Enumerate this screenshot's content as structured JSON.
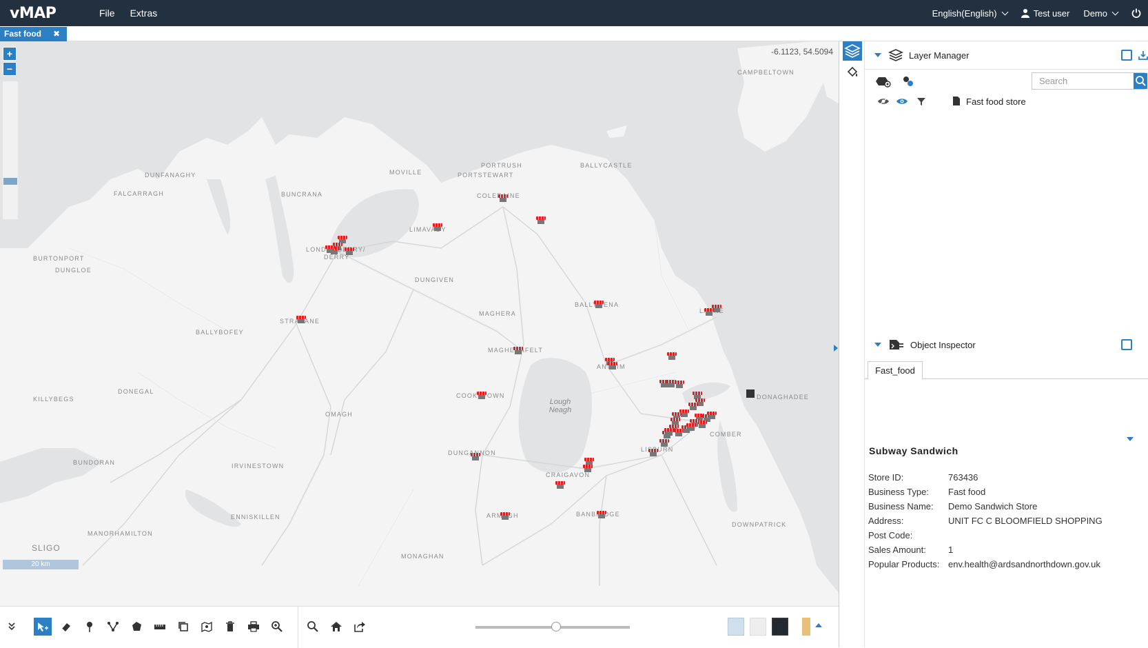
{
  "app": {
    "logo": "vMAP",
    "menu": [
      "File",
      "Extras"
    ],
    "language": "English(English)",
    "user": "Test user",
    "workspace": "Demo"
  },
  "tabs": [
    {
      "label": "Fast food",
      "close": "✖"
    }
  ],
  "map": {
    "coordinate": "-6.1123, 54.5094",
    "scale": "20 km",
    "zoom_in": "+",
    "zoom_out": "−",
    "places": [
      {
        "label": "CAMPBELTOWN"
      },
      {
        "label": "PORTRUSH"
      },
      {
        "label": "PORTSTEWART"
      },
      {
        "label": "BALLYCASTLE"
      },
      {
        "label": "MOVILLE"
      },
      {
        "label": "DUNFANAGHY"
      },
      {
        "label": "FALCARRAGH"
      },
      {
        "label": "BUNCRANA"
      },
      {
        "label": "COLERAINE"
      },
      {
        "label": "LIMAVADY"
      },
      {
        "label": "LONDONDERRY/"
      },
      {
        "label": "DERRY"
      },
      {
        "label": "BURTONPORT"
      },
      {
        "label": "DUNGLOE"
      },
      {
        "label": "DUNGIVEN"
      },
      {
        "label": "BALLYMENA"
      },
      {
        "label": "LARNE"
      },
      {
        "label": "STRABANE"
      },
      {
        "label": "MAGHERA"
      },
      {
        "label": "BALLYBOFEY"
      },
      {
        "label": "MAGHERAFELT"
      },
      {
        "label": "ANTRIM"
      },
      {
        "label": "DONEGAL"
      },
      {
        "label": "KILLYBEGS"
      },
      {
        "label": "COOKSTOWN"
      },
      {
        "label": "DONAGHADEE"
      },
      {
        "label": "OMAGH"
      },
      {
        "label": "COMBER"
      },
      {
        "label": "DUNGANNON"
      },
      {
        "label": "LISBURN"
      },
      {
        "label": "BUNDORAN"
      },
      {
        "label": "IRVINESTOWN"
      },
      {
        "label": "CRAIGAVON"
      },
      {
        "label": "ENNISKILLEN"
      },
      {
        "label": "ARMAGH"
      },
      {
        "label": "BANBRIDGE"
      },
      {
        "label": "DOWNPATRICK"
      },
      {
        "label": "MANORHAMILTON"
      },
      {
        "label": "SLIGO"
      },
      {
        "label": "MONAGHAN"
      }
    ],
    "water_label": "Lough\nNeagh"
  },
  "layer_manager": {
    "title": "Layer Manager",
    "search_placeholder": "Search",
    "layers": [
      {
        "name": "Fast food store"
      }
    ]
  },
  "object_inspector": {
    "title": "Object Inspector",
    "tab": "Fast_food",
    "feature_title": "Subway Sandwich",
    "attributes": [
      {
        "key": "Store ID:",
        "value": "763436"
      },
      {
        "key": "Business Type:",
        "value": "Fast food"
      },
      {
        "key": "Business Name:",
        "value": "Demo Sandwich Store"
      },
      {
        "key": "Address:",
        "value": "UNIT FC C BLOOMFIELD SHOPPING"
      },
      {
        "key": "Post Code:",
        "value": ""
      },
      {
        "key": "Sales Amount:",
        "value": "1"
      },
      {
        "key": "Popular Products:",
        "value": "env.health@ardsandnorthdown.gov.uk"
      }
    ]
  },
  "toolbar": {
    "tools": [
      "expand-icon",
      "select-icon",
      "eraser-icon",
      "point-icon",
      "line-icon",
      "polygon-icon",
      "measure-icon",
      "copy-icon",
      "map-pin-icon",
      "trash-icon",
      "print-icon",
      "zoom-extent-icon",
      "search-icon",
      "home-icon",
      "share-icon"
    ]
  },
  "colors": {
    "header": "#233040",
    "accent": "#2d7fc4",
    "marker": "#e02020",
    "map_land": "#f4f4f4",
    "map_water": "#e2e3e4"
  }
}
